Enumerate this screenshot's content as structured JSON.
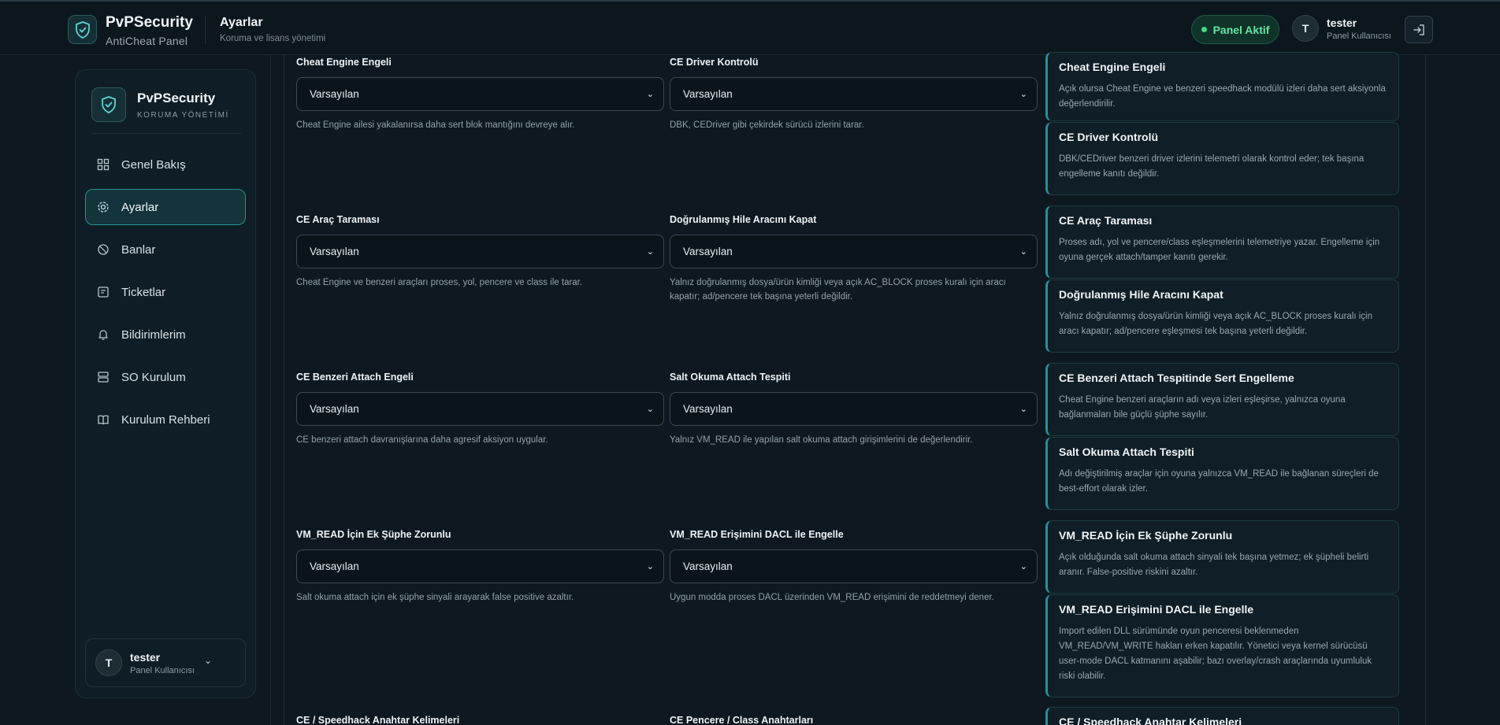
{
  "header": {
    "brand_title": "PvPSecurity",
    "brand_subtitle": "AntiCheat Panel",
    "page_title": "Ayarlar",
    "page_subtitle": "Koruma ve lisans yönetimi",
    "status": "Panel Aktif",
    "user_initial": "T",
    "user_name": "tester",
    "user_role": "Panel Kullanıcısı"
  },
  "sidebar": {
    "brand_title": "PvPSecurity",
    "brand_subtitle": "KORUMA YÖNETİMİ",
    "items": [
      {
        "label": "Genel Bakış",
        "icon": "grid-icon"
      },
      {
        "label": "Ayarlar",
        "icon": "gear-icon",
        "active": true
      },
      {
        "label": "Banlar",
        "icon": "ban-icon"
      },
      {
        "label": "Ticketlar",
        "icon": "ticket-icon"
      },
      {
        "label": "Bildirimlerim",
        "icon": "bell-icon"
      },
      {
        "label": "SO Kurulum",
        "icon": "server-icon"
      },
      {
        "label": "Kurulum Rehberi",
        "icon": "book-icon"
      }
    ],
    "user_initial": "T",
    "user_name": "tester",
    "user_role": "Panel Kullanıcısı"
  },
  "fields": [
    {
      "label": "Cheat Engine Engeli",
      "value": "Varsayılan",
      "hint": "Cheat Engine ailesi yakalanırsa daha sert blok mantığını devreye alır."
    },
    {
      "label": "CE Driver Kontrolü",
      "value": "Varsayılan",
      "hint": "DBK, CEDriver gibi çekirdek sürücü izlerini tarar."
    },
    {
      "label": "CE Araç Taraması",
      "value": "Varsayılan",
      "hint": "Cheat Engine ve benzeri araçları proses, yol, pencere ve class ile tarar."
    },
    {
      "label": "Doğrulanmış Hile Aracını Kapat",
      "value": "Varsayılan",
      "hint": "Yalnız doğrulanmış dosya/ürün kimliği veya açık AC_BLOCK proses kuralı için aracı kapatır; ad/pencere tek başına yeterli değildir."
    },
    {
      "label": "CE Benzeri Attach Engeli",
      "value": "Varsayılan",
      "hint": "CE benzeri attach davranışlarına daha agresif aksiyon uygular."
    },
    {
      "label": "Salt Okuma Attach Tespiti",
      "value": "Varsayılan",
      "hint": "Yalnız VM_READ ile yapılan salt okuma attach girişimlerini de değerlendirir."
    },
    {
      "label": "VM_READ İçin Ek Şüphe Zorunlu",
      "value": "Varsayılan",
      "hint": "Salt okuma attach için ek şüphe sinyali arayarak false positive azaltır."
    },
    {
      "label": "VM_READ Erişimini DACL ile Engelle",
      "value": "Varsayılan",
      "hint": "Uygun modda proses DACL üzerinden VM_READ erişimini de reddetmeyi dener."
    },
    {
      "label": "CE / Speedhack Anahtar Kelimeleri",
      "value": "",
      "hint": ""
    },
    {
      "label": "CE Pencere / Class Anahtarları",
      "value": "",
      "hint": ""
    }
  ],
  "cards": [
    {
      "title": "Cheat Engine Engeli",
      "desc": "Açık olursa Cheat Engine ve benzeri speedhack modülü izleri daha sert aksiyonla değerlendirilir."
    },
    {
      "title": "CE Driver Kontrolü",
      "desc": "DBK/CEDriver benzeri driver izlerini telemetri olarak kontrol eder; tek başına engelleme kanıtı değildir."
    },
    {
      "title": "CE Araç Taraması",
      "desc": "Proses adı, yol ve pencere/class eşleşmelerini telemetriye yazar. Engelleme için oyuna gerçek attach/tamper kanıtı gerekir."
    },
    {
      "title": "Doğrulanmış Hile Aracını Kapat",
      "desc": "Yalnız doğrulanmış dosya/ürün kimliği veya açık AC_BLOCK proses kuralı için aracı kapatır; ad/pencere eşleşmesi tek başına yeterli değildir."
    },
    {
      "title": "CE Benzeri Attach Tespitinde Sert Engelleme",
      "desc": "Cheat Engine benzeri araçların adı veya izleri eşleşirse, yalnızca oyuna bağlanmaları bile güçlü şüphe sayılır."
    },
    {
      "title": "Salt Okuma Attach Tespiti",
      "desc": "Adı değiştirilmiş araçlar için oyuna yalnızca VM_READ ile bağlanan süreçleri de best-effort olarak izler."
    },
    {
      "title": "VM_READ İçin Ek Şüphe Zorunlu",
      "desc": "Açık olduğunda salt okuma attach sinyali tek başına yetmez; ek şüpheli belirti aranır. False-positive riskini azaltır."
    },
    {
      "title": "VM_READ Erişimini DACL ile Engelle",
      "desc": "Import edilen DLL sürümünde oyun penceresi beklenmeden VM_READ/VM_WRITE hakları erken kapatılır. Yönetici veya kernel sürücüsü user-mode DACL katmanını aşabilir; bazı overlay/crash araçlarında uyumluluk riski olabilir."
    },
    {
      "title": "CE / Speedhack Anahtar Kelimeleri",
      "desc": ""
    }
  ],
  "colors": {
    "accent": "#2a8f98",
    "status_green": "#3fd98a",
    "background": "#0d1820"
  }
}
